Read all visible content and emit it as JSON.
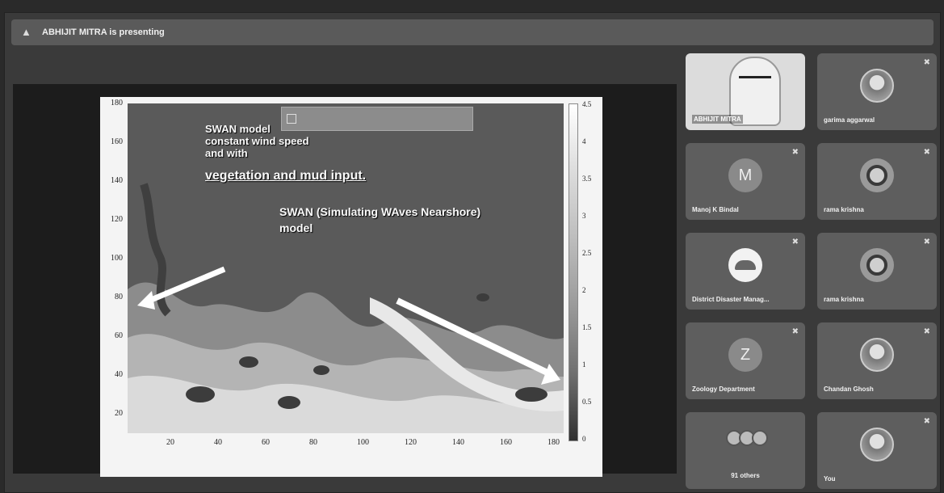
{
  "presenting_banner": "ABHIJIT MITRA is presenting",
  "slide": {
    "title_lines": [
      "SWAN model",
      "constant wind speed",
      "and with"
    ],
    "subtitle": "vegetation and mud input.",
    "model_line1": "SWAN (Simulating WAves Nearshore)",
    "model_line2": "model",
    "y_ticks": [
      "180",
      "160",
      "140",
      "120",
      "100",
      "80",
      "60",
      "40",
      "20"
    ],
    "x_ticks": [
      "20",
      "40",
      "60",
      "80",
      "100",
      "120",
      "140",
      "160",
      "180"
    ],
    "colorbar_ticks": [
      "4.5",
      "4",
      "3.5",
      "3",
      "2.5",
      "2",
      "1.5",
      "1",
      "0.5",
      "0"
    ]
  },
  "participants": [
    {
      "name": "ABHIJIT MITRA",
      "type": "camera"
    },
    {
      "name": "garima aggarwal",
      "type": "photo"
    },
    {
      "name": "Manoj K Bindal",
      "type": "letter",
      "letter": "M"
    },
    {
      "name": "rama krishna",
      "type": "ring"
    },
    {
      "name": "District Disaster Manag...",
      "type": "logo"
    },
    {
      "name": "rama krishna",
      "type": "ring"
    },
    {
      "name": "Zoology Department",
      "type": "letter",
      "letter": "Z"
    },
    {
      "name": "Chandan Ghosh",
      "type": "photo"
    },
    {
      "name": "91 others",
      "type": "others"
    },
    {
      "name": "You",
      "type": "photo"
    }
  ],
  "icons": {
    "presenting": "present-to-all-icon",
    "mic": "mic-off-icon"
  }
}
